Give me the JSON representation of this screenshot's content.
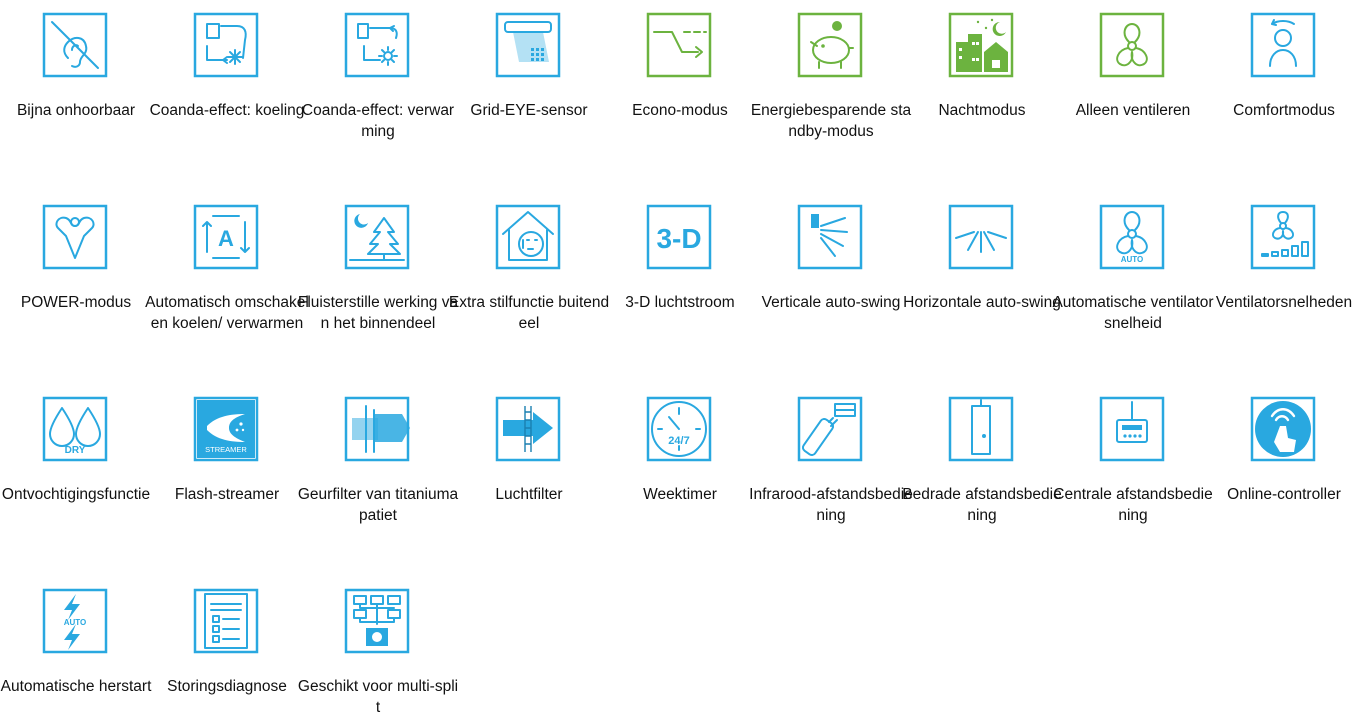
{
  "page": {
    "title": "",
    "accent_blue": "#29a8e0",
    "accent_green": "#6cb33f"
  },
  "features": [
    {
      "label": "Bijna onhoorbaar",
      "icon": "ear-crossed-icon",
      "color": "#29a8e0"
    },
    {
      "label": "Coanda-effect: koeling",
      "icon": "coanda-cooling-icon",
      "color": "#29a8e0"
    },
    {
      "label": "Coanda-effect: verwarming",
      "icon": "coanda-heating-icon",
      "color": "#29a8e0"
    },
    {
      "label": "Grid-EYE-sensor",
      "icon": "grid-eye-sensor-icon",
      "color": "#29a8e0"
    },
    {
      "label": "Econo-modus",
      "icon": "econo-mode-icon",
      "color": "#6cb33f"
    },
    {
      "label": "Energiebesparende standby-modus",
      "icon": "piggy-bank-icon",
      "color": "#6cb33f"
    },
    {
      "label": "Nachtmodus",
      "icon": "night-city-icon",
      "color": "#6cb33f"
    },
    {
      "label": "Alleen ventileren",
      "icon": "fan-icon",
      "color": "#6cb33f"
    },
    {
      "label": "Comfortmodus",
      "icon": "comfort-person-icon",
      "color": "#29a8e0"
    },
    {
      "label": "POWER-modus",
      "icon": "power-muscle-icon",
      "color": "#29a8e0"
    },
    {
      "label": "Automatisch omschakelen koelen/ verwarmen",
      "icon": "auto-changeover-icon",
      "color": "#29a8e0"
    },
    {
      "label": "Fluisterstille werking van het binnendeel",
      "icon": "quiet-tree-icon",
      "color": "#29a8e0"
    },
    {
      "label": "Extra stilfunctie buitendeel",
      "icon": "quiet-house-icon",
      "color": "#29a8e0"
    },
    {
      "label": "3-D luchtstroom",
      "icon": "3d-airflow-icon",
      "color": "#29a8e0"
    },
    {
      "label": "Verticale auto-swing",
      "icon": "vertical-swing-icon",
      "color": "#29a8e0"
    },
    {
      "label": "Horizontale auto-swing",
      "icon": "horizontal-swing-icon",
      "color": "#29a8e0"
    },
    {
      "label": "Automatische ventilatorsnelheid",
      "icon": "fan-auto-icon",
      "color": "#29a8e0"
    },
    {
      "label": "Ventilatorsnelheden",
      "icon": "fan-speeds-icon",
      "color": "#29a8e0"
    },
    {
      "label": "Ontvochtigingsfunctie",
      "icon": "dry-drops-icon",
      "color": "#29a8e0"
    },
    {
      "label": "Flash-streamer",
      "icon": "streamer-icon",
      "color": "#29a8e0"
    },
    {
      "label": "Geurfilter van titaniumapatiet",
      "icon": "odour-filter-icon",
      "color": "#29a8e0"
    },
    {
      "label": "Luchtfilter",
      "icon": "air-filter-icon",
      "color": "#29a8e0"
    },
    {
      "label": "Weektimer",
      "icon": "clock-24-7-icon",
      "color": "#29a8e0"
    },
    {
      "label": "Infrarood-afstandsbediening",
      "icon": "infrared-remote-icon",
      "color": "#29a8e0"
    },
    {
      "label": "Bedrade afstandsbediening",
      "icon": "wired-remote-icon",
      "color": "#29a8e0"
    },
    {
      "label": "Centrale afstandsbediening",
      "icon": "central-remote-icon",
      "color": "#29a8e0"
    },
    {
      "label": "Online-controller",
      "icon": "online-controller-icon",
      "color": "#29a8e0"
    },
    {
      "label": "Automatische herstart",
      "icon": "auto-restart-icon",
      "color": "#29a8e0"
    },
    {
      "label": "Storingsdiagnose",
      "icon": "diagnosis-list-icon",
      "color": "#29a8e0"
    },
    {
      "label": "Geschikt voor multi-split",
      "icon": "multi-split-icon",
      "color": "#29a8e0"
    }
  ],
  "badges": {
    "dry": "DRY",
    "streamer": "STREAMER",
    "auto": "AUTO",
    "three_d": "3-D",
    "clock": "24/7",
    "changeover": "A"
  }
}
